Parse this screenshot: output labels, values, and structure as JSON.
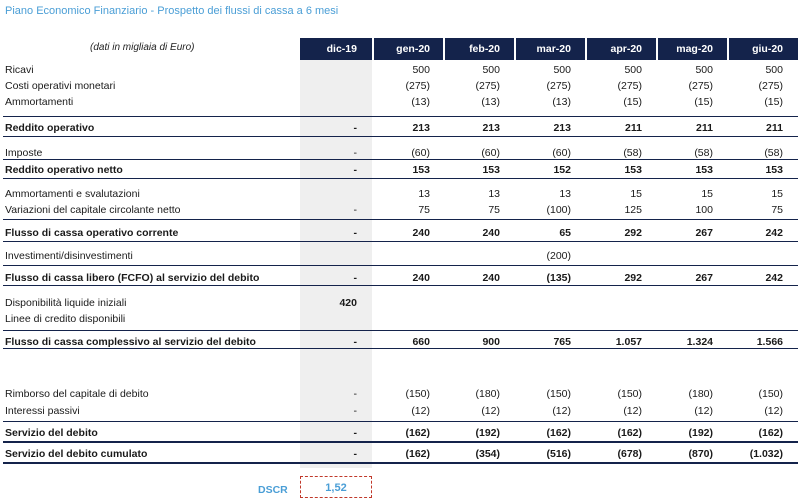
{
  "title": "Piano Economico Finanziario - Prospetto dei flussi di cassa a 6 mesi",
  "subnote": "(dati in migliaia di Euro)",
  "columns": [
    "dic-19",
    "gen-20",
    "feb-20",
    "mar-20",
    "apr-20",
    "mag-20",
    "giu-20"
  ],
  "rows": [
    {
      "label": "Ricavi",
      "values": [
        "",
        "500",
        "500",
        "500",
        "500",
        "500",
        "500"
      ],
      "bold": false
    },
    {
      "label": "Costi operativi monetari",
      "values": [
        "",
        "(275)",
        "(275)",
        "(275)",
        "(275)",
        "(275)",
        "(275)"
      ],
      "bold": false
    },
    {
      "label": "Ammortamenti",
      "values": [
        "",
        "(13)",
        "(13)",
        "(13)",
        "(15)",
        "(15)",
        "(15)"
      ],
      "bold": false
    },
    {
      "label": "Reddito operativo",
      "values": [
        "-",
        "213",
        "213",
        "213",
        "211",
        "211",
        "211"
      ],
      "bold": true
    },
    {
      "label": "Imposte",
      "values": [
        "-",
        "(60)",
        "(60)",
        "(60)",
        "(58)",
        "(58)",
        "(58)"
      ],
      "bold": false
    },
    {
      "label": "Reddito operativo netto",
      "values": [
        "-",
        "153",
        "153",
        "152",
        "153",
        "153",
        "153"
      ],
      "bold": true
    },
    {
      "label": "Ammortamenti e svalutazioni",
      "values": [
        "",
        "13",
        "13",
        "13",
        "15",
        "15",
        "15"
      ],
      "bold": false
    },
    {
      "label": "Variazioni del capitale circolante netto",
      "values": [
        "-",
        "75",
        "75",
        "(100)",
        "125",
        "100",
        "75"
      ],
      "bold": false
    },
    {
      "label": "Flusso di cassa operativo corrente",
      "values": [
        "-",
        "240",
        "240",
        "65",
        "292",
        "267",
        "242"
      ],
      "bold": true
    },
    {
      "label": "Investimenti/disinvestimenti",
      "values": [
        "",
        "",
        "",
        "(200)",
        "",
        "",
        ""
      ],
      "bold": false
    },
    {
      "label": "Flusso di cassa libero (FCFO) al servizio del debito",
      "values": [
        "-",
        "240",
        "240",
        "(135)",
        "292",
        "267",
        "242"
      ],
      "bold": true
    },
    {
      "label": "Disponibilità liquide iniziali",
      "values": [
        "420",
        "",
        "",
        "",
        "",
        "",
        ""
      ],
      "bold": false,
      "first_bold": true
    },
    {
      "label": "Linee di credito disponibili",
      "values": [
        "",
        "",
        "",
        "",
        "",
        "",
        ""
      ],
      "bold": false
    },
    {
      "label": "Flusso di cassa complessivo al servizio del debito",
      "values": [
        "-",
        "660",
        "900",
        "765",
        "1.057",
        "1.324",
        "1.566"
      ],
      "bold": true
    },
    {
      "label": "Rimborso del capitale di debito",
      "values": [
        "-",
        "(150)",
        "(180)",
        "(150)",
        "(150)",
        "(180)",
        "(150)"
      ],
      "bold": false
    },
    {
      "label": "Interessi passivi",
      "values": [
        "-",
        "(12)",
        "(12)",
        "(12)",
        "(12)",
        "(12)",
        "(12)"
      ],
      "bold": false
    },
    {
      "label": "Servizio del debito",
      "values": [
        "-",
        "(162)",
        "(192)",
        "(162)",
        "(162)",
        "(192)",
        "(162)"
      ],
      "bold": true
    },
    {
      "label": "Servizio del debito cumulato",
      "values": [
        "-",
        "(162)",
        "(354)",
        "(516)",
        "(678)",
        "(870)",
        "(1.032)"
      ],
      "bold": true
    }
  ],
  "dscr": {
    "label": "DSCR",
    "value": "1,52"
  },
  "colors": {
    "header_bg": "#14234b",
    "title": "#4a9ed6",
    "shade": "#efefef",
    "dscr_border": "#c0392b"
  }
}
